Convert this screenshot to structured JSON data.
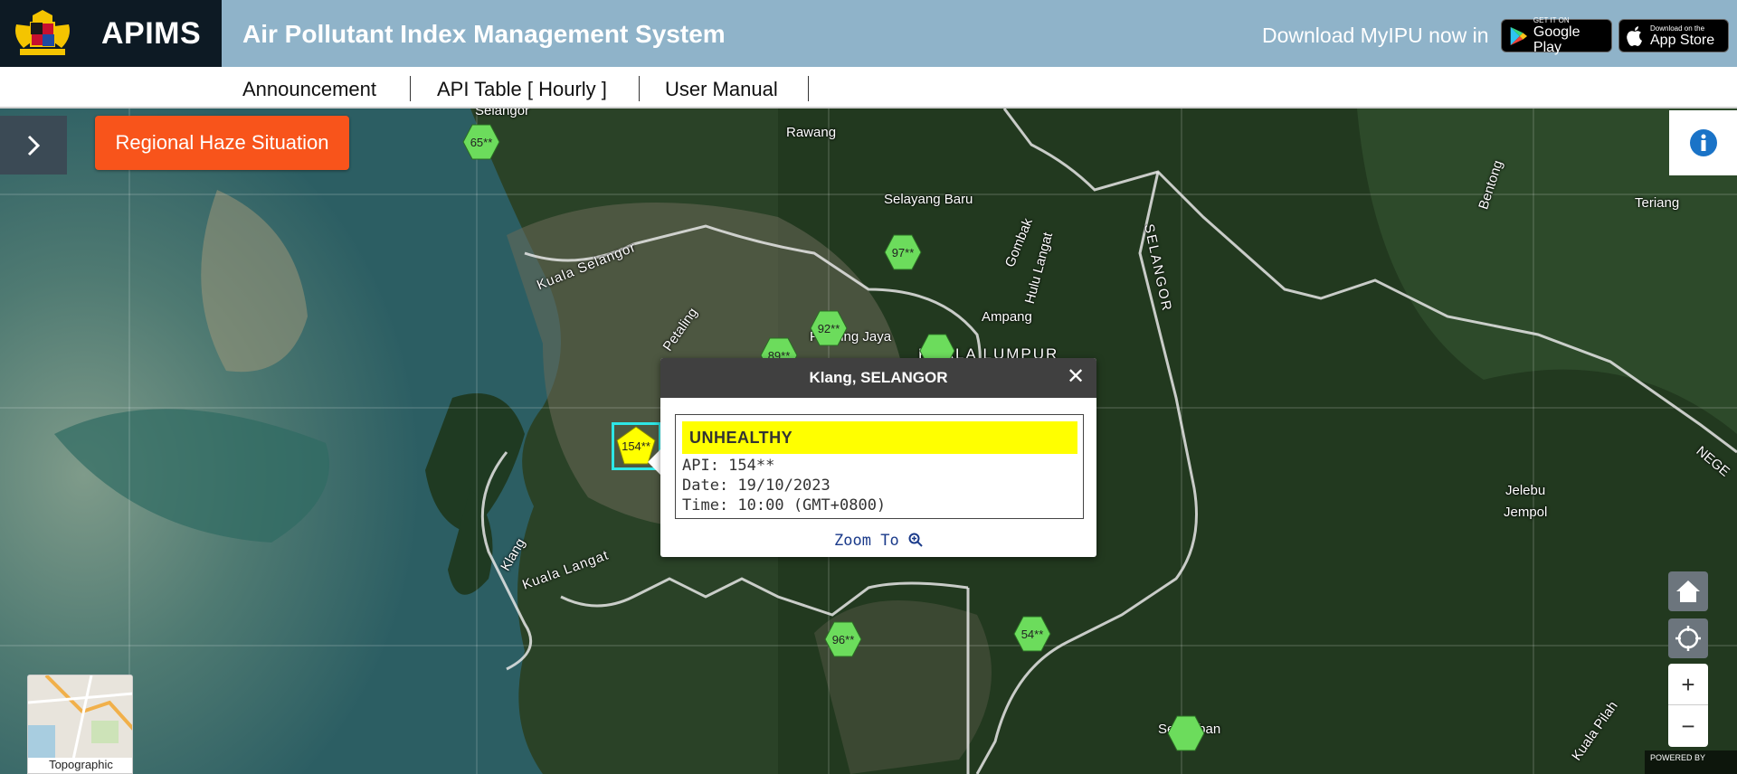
{
  "header": {
    "brand": "APIMS",
    "title": "Air Pollutant Index Management System",
    "download_text": "Download MyIPU now in",
    "google_play_small": "GET IT ON",
    "google_play_big": "Google Play",
    "app_store_small": "Download on the",
    "app_store_big": "App Store"
  },
  "nav": {
    "items": [
      "Announcement",
      "API Table [ Hourly ]",
      "User Manual"
    ]
  },
  "map": {
    "haze_button": "Regional Haze Situation",
    "stations": [
      {
        "label": "65**",
        "color": "#6cdc5c"
      },
      {
        "label": "97**",
        "color": "#6cdc5c"
      },
      {
        "label": "92**",
        "color": "#6cdc5c"
      },
      {
        "label": "89**",
        "color": "#6cdc5c"
      },
      {
        "label": "154**",
        "color": "#ffff00"
      },
      {
        "label": "96**",
        "color": "#6cdc5c"
      },
      {
        "label": "54**",
        "color": "#6cdc5c"
      }
    ],
    "places": [
      "Selangor",
      "Rawang",
      "Selayang Baru",
      "Gombak",
      "Hulu Langat",
      "SELANGOR",
      "Kuala Selangor",
      "Petaling",
      "Petaling Jaya",
      "Ampang",
      "KUALA LUMPUR",
      "Klang",
      "Kuala Langat",
      "Seremban",
      "Bentong",
      "Teriang",
      "Jelebu",
      "Jempol",
      "NEGE",
      "Kuala Pilah"
    ],
    "basemap_label": "Topographic",
    "attribution": "POWERED BY"
  },
  "popup": {
    "title": "Klang, SELANGOR",
    "status": "UNHEALTHY",
    "status_color": "#ffff00",
    "api": "API: 154**",
    "date": "Date: 19/10/2023",
    "time": "Time: 10:00 (GMT+0800)",
    "zoom_to": "Zoom To"
  }
}
